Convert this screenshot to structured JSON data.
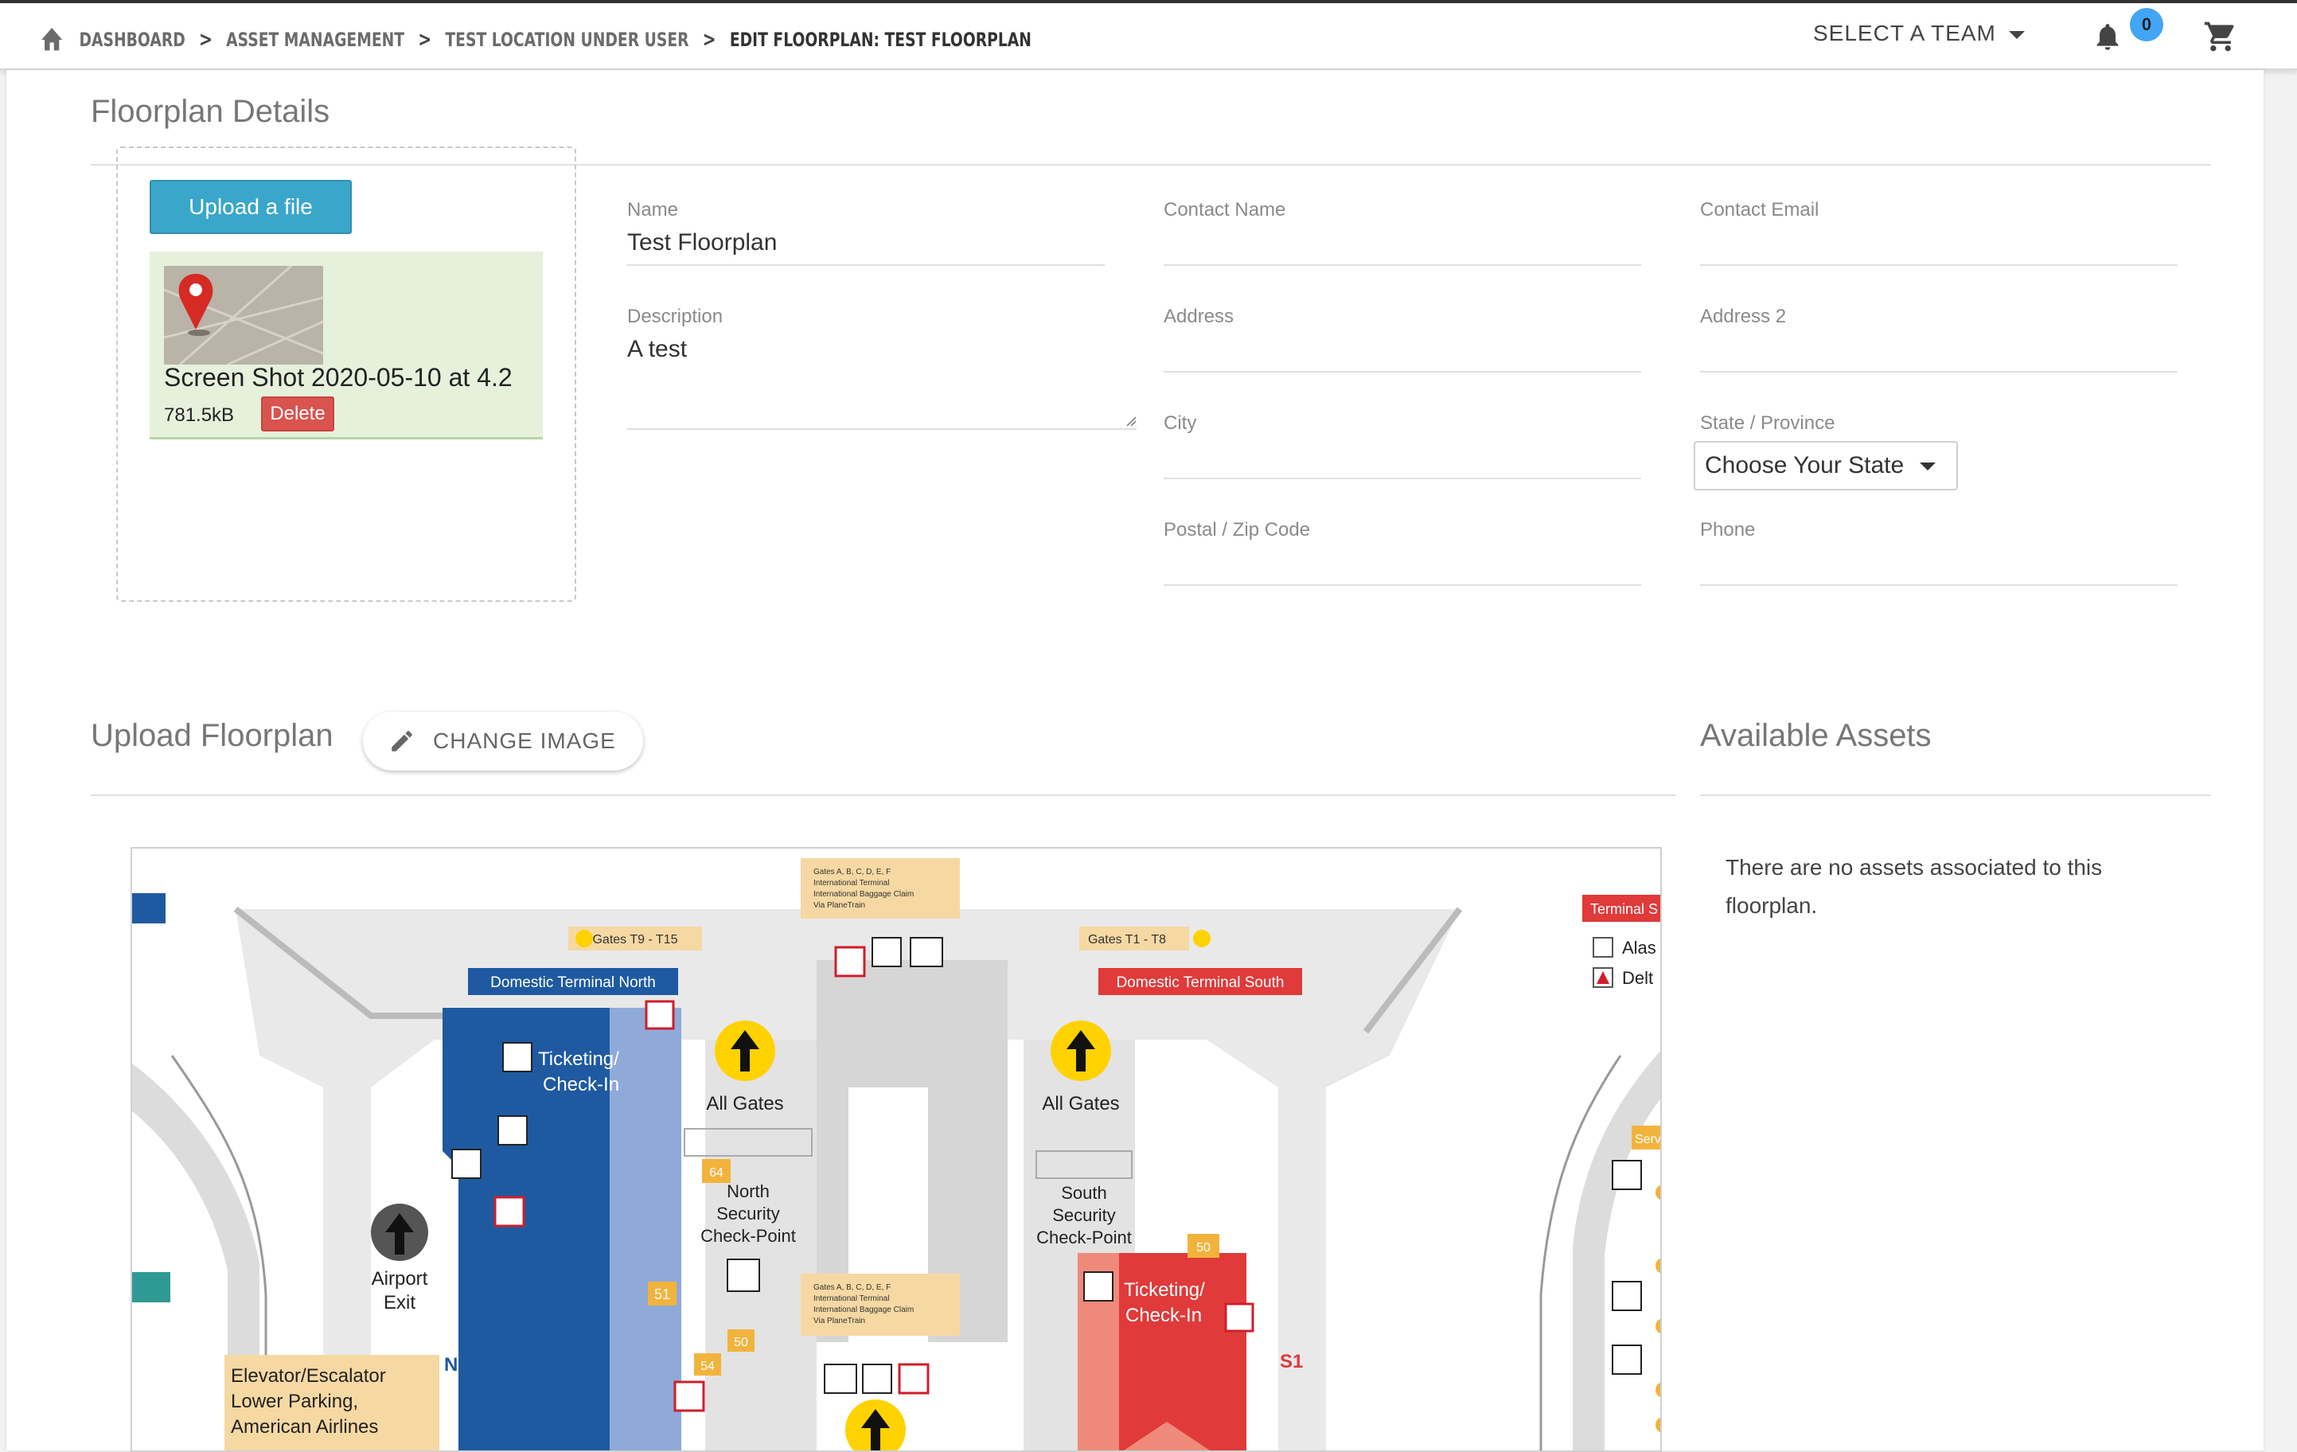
{
  "topbar": {
    "breadcrumbs": [
      "Dashboard",
      "Asset Management",
      "Test Location Under User",
      "Edit Floorplan: Test Floorplan"
    ],
    "separator": ">",
    "team_label": "SELECT A TEAM",
    "notification_count": "0",
    "icons": [
      "home-icon",
      "bell-icon",
      "cart-icon"
    ]
  },
  "details": {
    "title": "Floorplan Details",
    "upload_label": "Upload a file",
    "file": {
      "name": "Screen Shot 2020-05-10 at 4.2",
      "size": "781.5kB",
      "delete_label": "Delete"
    },
    "fields": {
      "name": {
        "label": "Name",
        "value": "Test Floorplan"
      },
      "description": {
        "label": "Description",
        "value": "A test"
      },
      "contact_name": {
        "label": "Contact Name",
        "value": ""
      },
      "contact_email": {
        "label": "Contact Email",
        "value": ""
      },
      "address": {
        "label": "Address",
        "value": ""
      },
      "address2": {
        "label": "Address 2",
        "value": ""
      },
      "city": {
        "label": "City",
        "value": ""
      },
      "state": {
        "label": "State / Province",
        "value": "Choose Your State"
      },
      "postal": {
        "label": "Postal / Zip Code",
        "value": ""
      },
      "phone": {
        "label": "Phone",
        "value": ""
      }
    }
  },
  "floorplan": {
    "title": "Upload Floorplan",
    "change_label": "CHANGE IMAGE",
    "map": {
      "gates_top": "Gates A, B, C, D, E, F",
      "gates_top_2": "International Terminal",
      "gates_top_3": "International Baggage Claim",
      "gates_top_4": "Via PlaneTrain",
      "gates_left": "Gates T9 - T15",
      "gates_right": "Gates T1 - T8",
      "north_banner": "Domestic Terminal North",
      "south_banner": "Domestic Terminal South",
      "ticketing": "Ticketing/",
      "checkin": "Check-In",
      "all_gates": "All Gates",
      "north_sec_1": "North",
      "north_sec_2": "Security",
      "north_sec_3": "Check-Point",
      "south_sec_1": "South",
      "south_sec_2": "Security",
      "south_sec_3": "Check-Point",
      "airport": "Airport",
      "exit": "Exit",
      "elevator_1": "Elevator/Escalator",
      "elevator_2": "Lower Parking,",
      "elevator_3": "American Airlines",
      "terminal_tag": "Terminal S",
      "legend_1": "Alas",
      "legend_2": "Delt",
      "n6": "N6",
      "s1": "S1",
      "num_64": "64",
      "num_51": "51",
      "num_50": "50",
      "num_54": "54",
      "serv_tag": "Serv"
    }
  },
  "assets": {
    "title": "Available Assets",
    "empty_message": "There are no assets associated to this floorplan."
  },
  "colors": {
    "accent": "#3aa6c9",
    "delete": "#d9534f",
    "badge": "#42a5f5",
    "north": "#1f5aa0",
    "south": "#e03a3a"
  }
}
